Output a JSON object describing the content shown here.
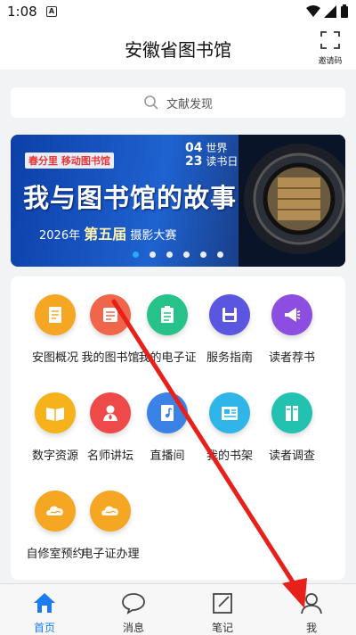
{
  "status": {
    "time": "1:08"
  },
  "header": {
    "title": "安徽省图书馆",
    "invite_label": "邀请码"
  },
  "search": {
    "placeholder": "文献发现"
  },
  "banner": {
    "logo": "春分里 移动图书馆",
    "date_top": "04",
    "date_top_text": "世界",
    "date_bottom": "23",
    "date_bottom_text": "读书日",
    "headline": "我与图书馆的故事",
    "year_text": "2026年",
    "edition_text": "第五届",
    "contest_text": "摄影大赛",
    "dot_count": 6,
    "active_dot": 0
  },
  "services": [
    {
      "label": "安图概况",
      "color": "#f5a623",
      "icon": "doc-icon"
    },
    {
      "label": "我的图书馆",
      "color": "#f0664a",
      "icon": "library-icon"
    },
    {
      "label": "我的电子证",
      "color": "#27c289",
      "icon": "clipboard-icon"
    },
    {
      "label": "服务指南",
      "color": "#5b56e0",
      "icon": "save-icon"
    },
    {
      "label": "读者荐书",
      "color": "#8b4ee0",
      "icon": "megaphone-icon"
    },
    {
      "label": "数字资源",
      "color": "#f5b21b",
      "icon": "book-open-icon"
    },
    {
      "label": "名师讲坛",
      "color": "#ee4a4a",
      "icon": "lecturer-icon"
    },
    {
      "label": "直播间",
      "color": "#3b82e6",
      "icon": "music-doc-icon"
    },
    {
      "label": "我的书架",
      "color": "#2fb5e8",
      "icon": "news-icon"
    },
    {
      "label": "读者调查",
      "color": "#22c1b0",
      "icon": "books-icon"
    },
    {
      "label": "自修室预约",
      "color": "#f5a623",
      "icon": "cloud-icon"
    },
    {
      "label": "电子证办理",
      "color": "#f5a623",
      "icon": "cloud-icon"
    }
  ],
  "tabs": [
    {
      "label": "首页",
      "icon": "home-icon",
      "active": true
    },
    {
      "label": "消息",
      "icon": "message-icon",
      "active": false
    },
    {
      "label": "笔记",
      "icon": "note-icon",
      "active": false
    },
    {
      "label": "我",
      "icon": "user-icon",
      "active": false
    }
  ],
  "colors": {
    "accent": "#1a7cf0",
    "annotation_arrow": "#e8201a"
  }
}
